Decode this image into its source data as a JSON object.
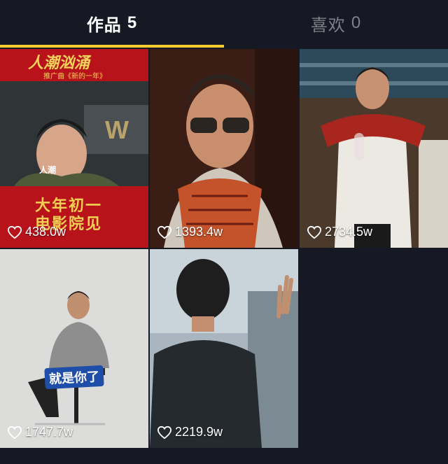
{
  "tabs": [
    {
      "label": "作品",
      "count": "5",
      "active": true
    },
    {
      "label": "喜欢",
      "count": "0",
      "active": false
    }
  ],
  "accent_color": "#f8cb2e",
  "posts": [
    {
      "likes": "438.0w",
      "overlay": {
        "title": "人潮汹涌",
        "subtitle": "推广曲《新的一年》",
        "name_tag": "人潮",
        "bottom_line1": "大年初一",
        "bottom_line2": "电影院见"
      }
    },
    {
      "likes": "1393.4w"
    },
    {
      "likes": "2734.5w"
    },
    {
      "likes": "1747.7w",
      "overlay": {
        "caption": "就是你了"
      }
    },
    {
      "likes": "2219.9w"
    }
  ],
  "icons": {
    "like": "heart-outline-icon"
  }
}
